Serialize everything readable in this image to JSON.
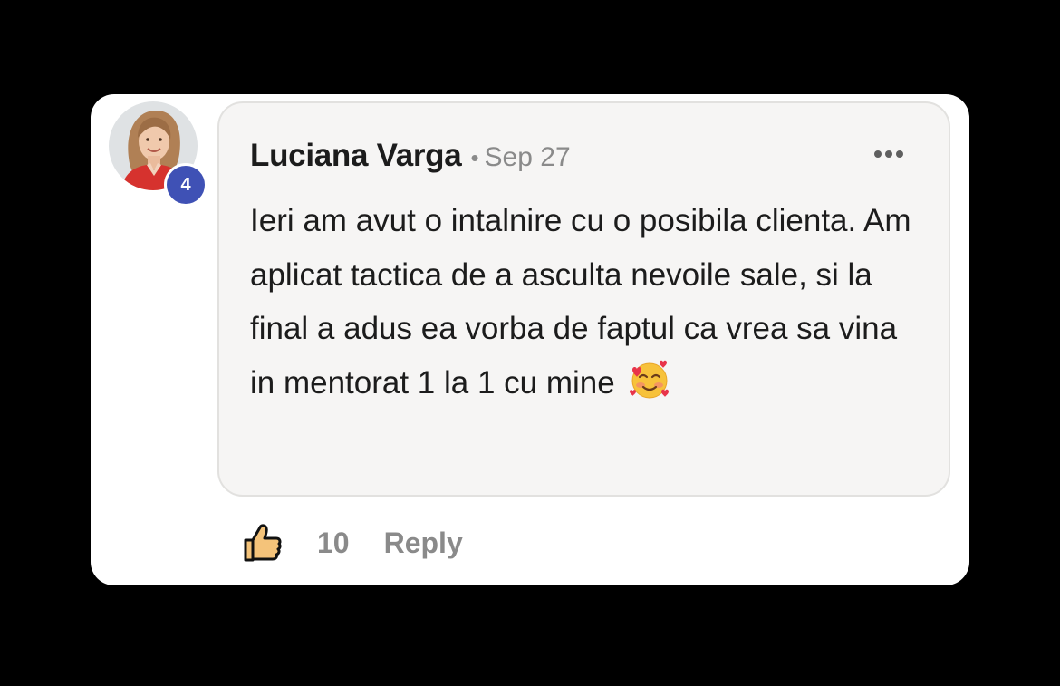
{
  "comment": {
    "author": "Luciana Varga",
    "separator": "•",
    "date": "Sep 27",
    "level": "4",
    "text": "Ieri am avut o intalnire cu o posibila clienta. Am aplicat tactica de a asculta nevoile sale, si la final a adus ea vorba de faptul ca vrea sa vina in mentorat 1 la 1 cu mine",
    "emoji": "smiling-face-with-hearts-icon",
    "more_icon": "more-horizontal-icon",
    "avatar_icon": "profile-photo"
  },
  "actions": {
    "like_icon": "thumbs-up-icon",
    "like_count": "10",
    "reply_label": "Reply"
  },
  "colors": {
    "background": "#000000",
    "card": "#ffffff",
    "bubble": "#f6f5f4",
    "badge": "#3f51b5",
    "muted_text": "#8a8a8a",
    "primary_text": "#1c1c1c"
  }
}
